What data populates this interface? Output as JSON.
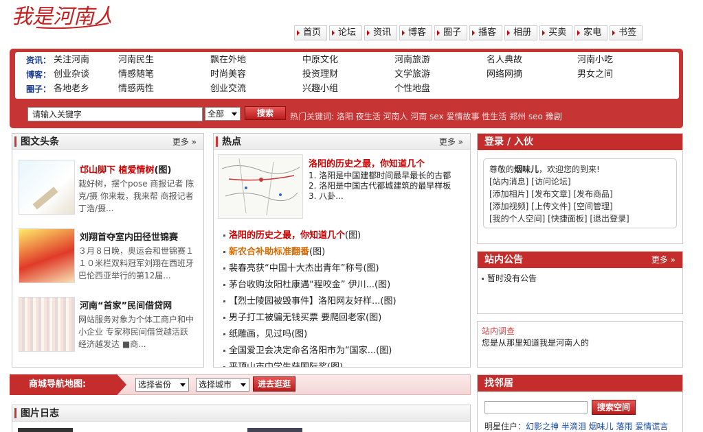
{
  "logo": {
    "text": "我是河南人"
  },
  "nav": [
    "首页",
    "论坛",
    "资讯",
    "博客",
    "圈子",
    "播客",
    "相册",
    "买卖",
    "家电",
    "书签"
  ],
  "links": {
    "rows": [
      {
        "label": "资讯：",
        "items": [
          "关注河南",
          "河南民生",
          "飘在外地",
          "中原文化",
          "河南旅游",
          "名人典故",
          "河南小吃"
        ]
      },
      {
        "label": "博客：",
        "items": [
          "创业杂谈",
          "情感随笔",
          "时尚美容",
          "投资理财",
          "文学旅游",
          "网络网摘",
          "男女之间"
        ]
      },
      {
        "label": "圈子：",
        "items": [
          "各地老乡",
          "情感两性",
          "创业交流",
          "兴趣小组",
          "个性地盘"
        ]
      }
    ]
  },
  "search": {
    "placeholder": "请输入关键字",
    "scope": "全部",
    "button": "搜索",
    "hot_prefix": "热门关键词:",
    "hot": "洛阳 夜生活 河南人 河南 sex 爱情故事 性生活 郑州 seo 豫剧"
  },
  "news": {
    "title": "图文头条",
    "more": "更多 »",
    "items": [
      {
        "title": "邙山脚下  植爱情树",
        "suffix": "(图)",
        "desc": "栽好树，摆个pose      商报记者 陈克/摄 你来栽，我来帮     商报记者 丁浩/摄..."
      },
      {
        "title": "刘翔首夺室内田径世锦赛",
        "desc": "３月８日晚，奥运会和世锦赛１１０米栏双料冠军刘翔在西班牙巴伦西亚举行的第12届..."
      },
      {
        "title": "河南“首家”民间借贷网",
        "desc": "网站服务对象为个体工商户和中小企业 专家称民间借贷越活跃经济越发达      ■商..."
      }
    ]
  },
  "hot": {
    "title": "热点",
    "more": "更多 »",
    "feature": {
      "title": "洛阳的历史之最，你知道几个",
      "lines": [
        "1. 洛阳是中国建都时间最早最长的古都",
        "2. 洛阳是中国古代都城建筑的最早样板",
        "3. 八卦..."
      ]
    },
    "list": [
      {
        "text": "洛阳的历史之最，你知道几个",
        "suffix": "(图)",
        "color": "#c00",
        "bold": true
      },
      {
        "text": "新农合补助标准翻番",
        "suffix": "(图)",
        "color": "#d86a00",
        "bold": true
      },
      {
        "text": "裴春亮获“中国十大杰出青年”称号",
        "suffix": "(图)"
      },
      {
        "text": "茅台收购汝阳杜康遇“程咬金” 伊川...",
        "suffix": "(图)"
      },
      {
        "text": "【烈士陵园被毁事件】洛阳网友好样...",
        "suffix": "(图)"
      },
      {
        "text": "男子打工被骗无钱买票 要爬回老家",
        "suffix": "(图)"
      },
      {
        "text": "纸雕画，见过吗",
        "suffix": "(图)"
      },
      {
        "text": "全国爱卫会决定命名洛阳市为“国家...",
        "suffix": "(图)"
      },
      {
        "text": "平顶山市中学生获国际奖",
        "suffix": "(图)"
      }
    ]
  },
  "login": {
    "title": "登录 / 入伙",
    "greet_pre": "尊敬的",
    "user": "烟味儿",
    "greet_post": "，欢迎您的到来!",
    "links": [
      "[站内消息] [访问论坛]",
      "[添加相片] [发布文章] [发布商品]",
      "[添加视频] [上传文件] [空间管理]",
      "[我的个人空间] [快捷面板] [退出登录]"
    ]
  },
  "notice": {
    "title": "站内公告",
    "more": "更多 »",
    "text": "暂时没有公告"
  },
  "survey": {
    "title": "站内调查",
    "text": "您是从那里知道我是河南人的"
  },
  "mall": {
    "label": "商城导航地图:",
    "province": "选择省份",
    "city": "选择城市",
    "go": "进去逛逛"
  },
  "photo": {
    "title": "图片日志"
  },
  "neighbor": {
    "title": "找邻居",
    "button": "搜索空间",
    "star_label": "明星住户：",
    "stars": "幻影之神 半滴泪 烟味儿 落雨 爱情谎言"
  }
}
